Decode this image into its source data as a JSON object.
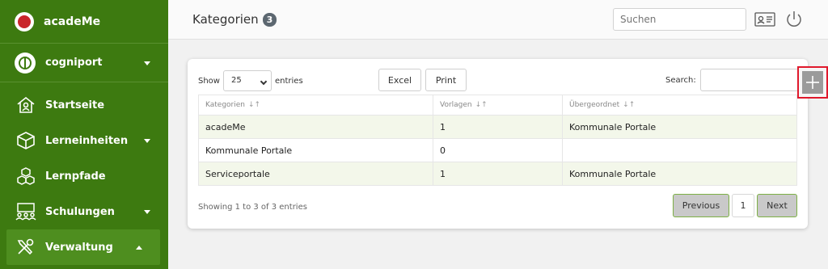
{
  "app": {
    "name": "acadeMe"
  },
  "org": {
    "name": "cogniport"
  },
  "nav": {
    "items": [
      {
        "label": "Startseite"
      },
      {
        "label": "Lerneinheiten"
      },
      {
        "label": "Lernpfade"
      },
      {
        "label": "Schulungen"
      },
      {
        "label": "Verwaltung"
      }
    ]
  },
  "header": {
    "title": "Kategorien",
    "count": "3",
    "search_placeholder": "Suchen"
  },
  "controls": {
    "show_label": "Show",
    "entries_label": "entries",
    "page_length": "25",
    "excel_label": "Excel",
    "print_label": "Print",
    "search_label": "Search:"
  },
  "table": {
    "columns": [
      "Kategorien",
      "Vorlagen",
      "Übergeordnet"
    ],
    "rows": [
      [
        "acadeMe",
        "1",
        "Kommunale Portale"
      ],
      [
        "Kommunale Portale",
        "0",
        ""
      ],
      [
        "Serviceportale",
        "1",
        "Kommunale Portale"
      ]
    ]
  },
  "footer": {
    "info": "Showing 1 to 3 of 3 entries",
    "previous_label": "Previous",
    "current_page": "1",
    "next_label": "Next"
  },
  "colors": {
    "sidebar": "#3d7a10",
    "accent_border": "#7db045",
    "highlight": "#e0192c"
  },
  "icons": {
    "brand": "lightbulb-icon",
    "org": "puzzle-icon",
    "home": "home-icon",
    "cube": "cube-icon",
    "cubes": "cubes-icon",
    "group": "group-icon",
    "tools": "tools-icon",
    "id_card": "id-card-icon",
    "power": "power-icon",
    "add": "plus-icon"
  }
}
